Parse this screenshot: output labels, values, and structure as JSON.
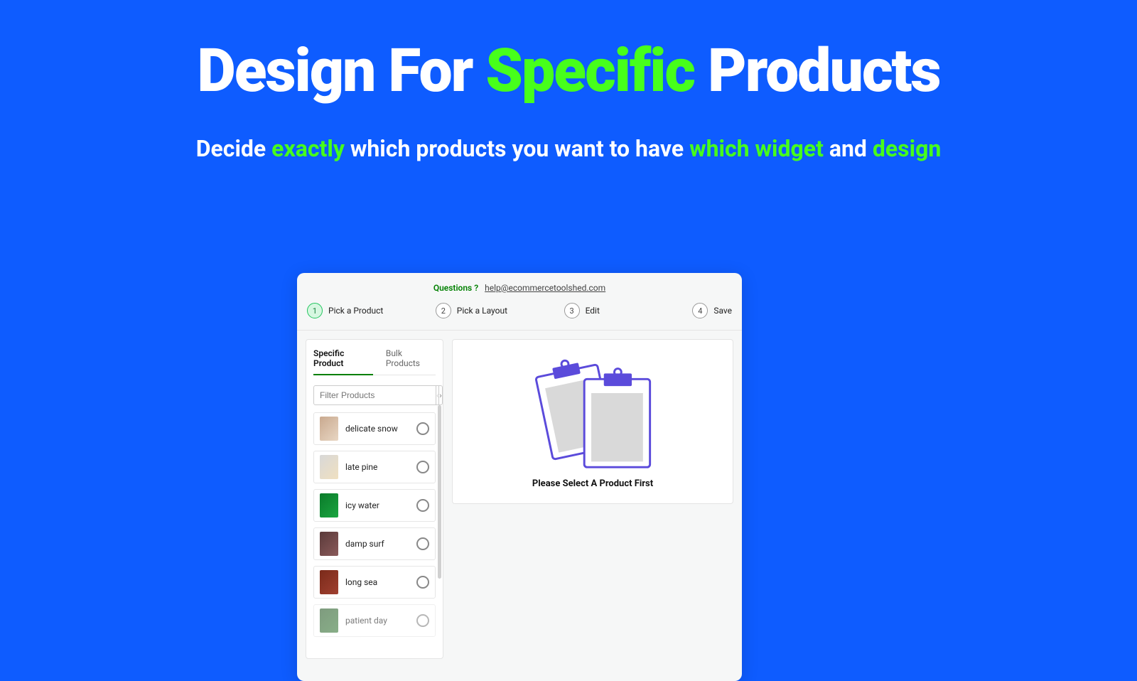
{
  "hero": {
    "title_pre": "Design For ",
    "title_hl": "Specific",
    "title_post": " Products",
    "sub_pre": "Decide ",
    "sub_hl1": "exactly",
    "sub_mid": " which products you want to have ",
    "sub_hl2": "which widget",
    "sub_and": " and ",
    "sub_hl3": "design"
  },
  "questions": {
    "label": "Questions ?",
    "email": "help@ecommercetoolshed.com"
  },
  "steps": [
    {
      "num": "1",
      "label": "Pick a Product",
      "active": true
    },
    {
      "num": "2",
      "label": "Pick a Layout",
      "active": false
    },
    {
      "num": "3",
      "label": "Edit",
      "active": false
    },
    {
      "num": "4",
      "label": "Save",
      "active": false
    }
  ],
  "sidebar": {
    "tabs": {
      "specific": "Specific Product",
      "bulk": "Bulk Products"
    },
    "filter_placeholder": "Filter Products",
    "products": [
      {
        "name": "delicate snow",
        "color1": "#c9a98f",
        "color2": "#e8d6c3"
      },
      {
        "name": "late pine",
        "color1": "#d8d8d8",
        "color2": "#f0e0c0"
      },
      {
        "name": "icy water",
        "color1": "#0a7a2a",
        "color2": "#1aa540"
      },
      {
        "name": "damp surf",
        "color1": "#5a3a3a",
        "color2": "#8a5a5a"
      },
      {
        "name": "long sea",
        "color1": "#7a2a1a",
        "color2": "#a04030"
      },
      {
        "name": "patient day",
        "color1": "#2a5a2a",
        "color2": "#3a7a3a"
      }
    ]
  },
  "right": {
    "empty_message": "Please Select A Product First"
  },
  "colors": {
    "bg": "#0e5cff",
    "highlight": "#47ff1b",
    "accent_green": "#22c55e",
    "clip_purple": "#5b4bdb"
  }
}
